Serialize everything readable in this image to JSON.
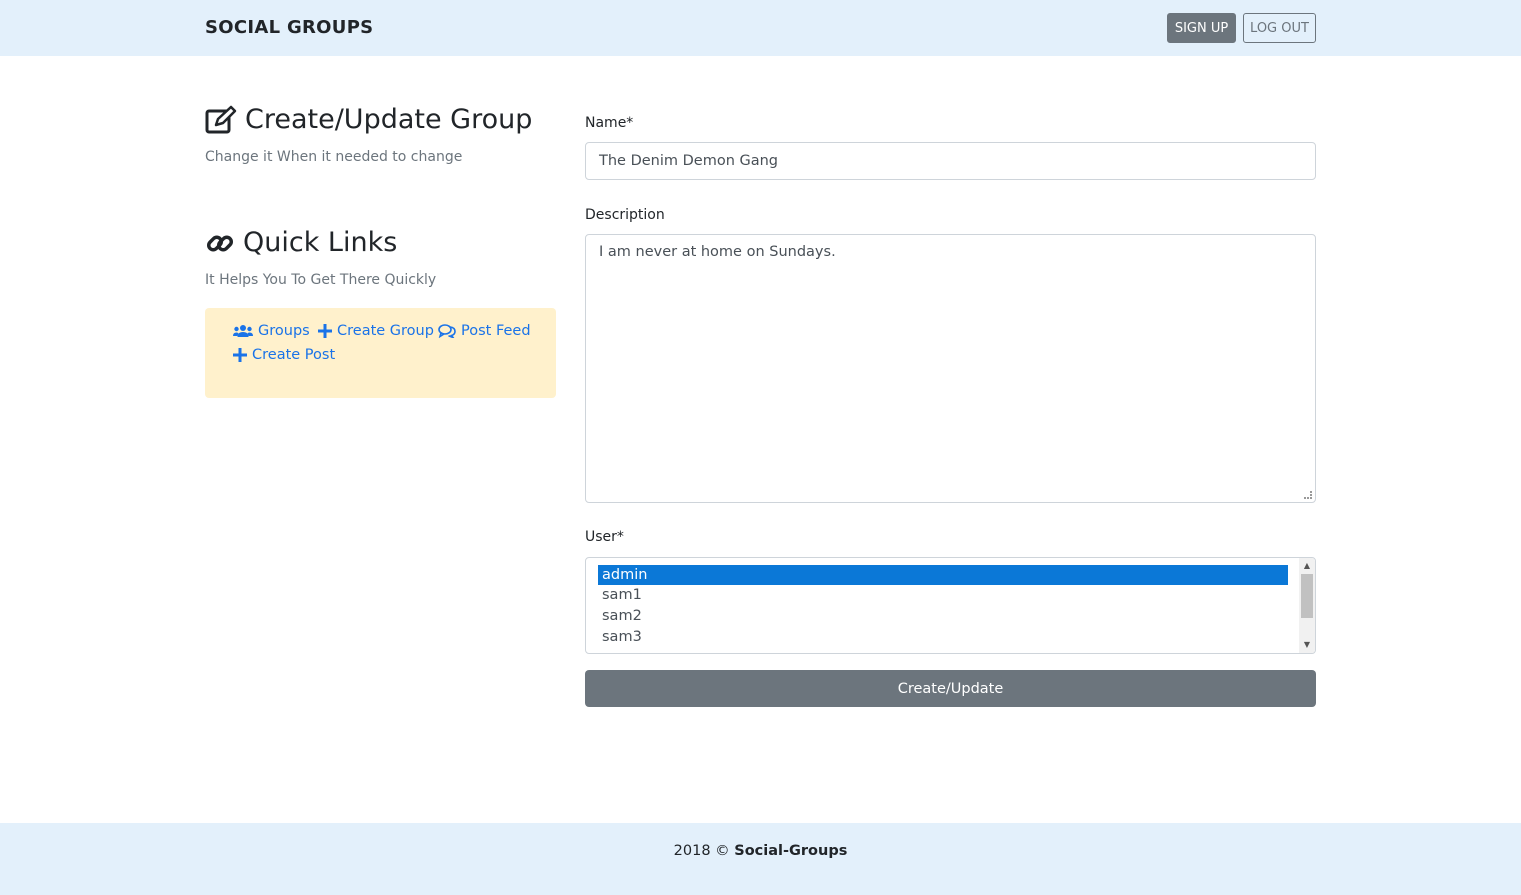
{
  "navbar": {
    "brand": "SOCIAL GROUPS",
    "signup_label": "SIGN UP",
    "logout_label": "LOG OUT"
  },
  "sidebar": {
    "title": "Create/Update Group",
    "subtitle": "Change it When it needed to change",
    "title_icon": "edit-icon",
    "quick_links": {
      "title": "Quick Links",
      "subtitle": "It Helps You To Get There Quickly",
      "title_icon": "link-icon",
      "items": [
        {
          "label": "Groups",
          "icon": "users-icon"
        },
        {
          "label": "Create Group",
          "icon": "plus-icon"
        },
        {
          "label": "Post Feed",
          "icon": "comments-icon"
        },
        {
          "label": "Create Post",
          "icon": "plus-icon"
        }
      ]
    }
  },
  "form": {
    "name_label": "Name*",
    "name_value": "The Denim Demon Gang",
    "description_label": "Description",
    "description_value": "I am never at home on Sundays.",
    "user_label": "User*",
    "user_options": [
      "admin",
      "sam1",
      "sam2",
      "sam3"
    ],
    "user_selected": "admin",
    "submit_label": "Create/Update"
  },
  "footer": {
    "year": "2018 ©",
    "site": "Social-Groups"
  },
  "colors": {
    "navbar_bg": "#e3f0fb",
    "quick_links_bg": "#fff1cc",
    "link": "#1a73e8",
    "button_secondary": "#6c757d",
    "selected_option": "#0b78d7"
  }
}
